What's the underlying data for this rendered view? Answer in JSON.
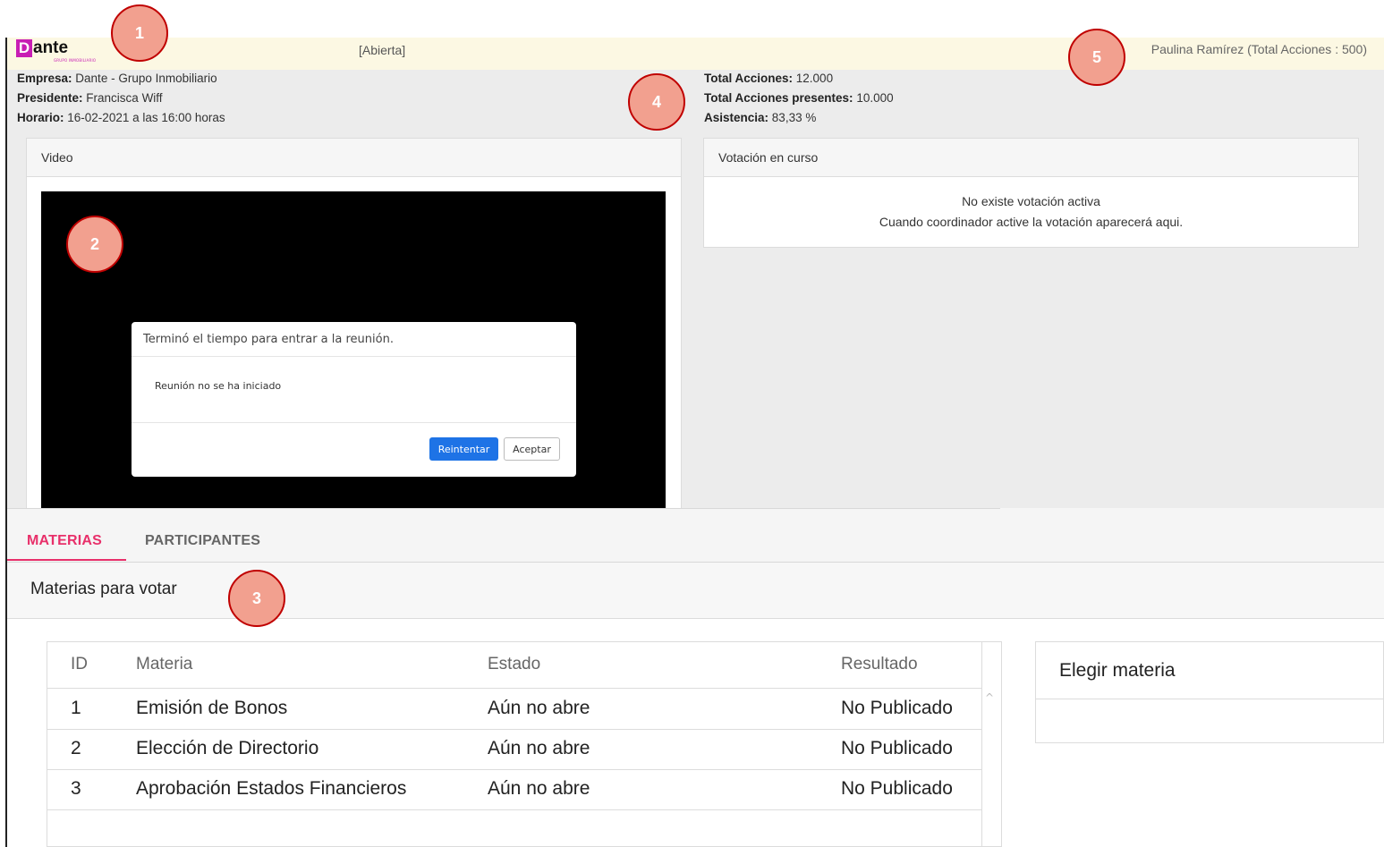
{
  "header": {
    "logo": {
      "letter": "D",
      "rest": "ante",
      "subtitle": "GRUPO INMOBILIARIO"
    },
    "status": "[Abierta]",
    "user": "Paulina Ramírez (Total Acciones : 500)"
  },
  "meeting_info": {
    "empresa_label": "Empresa:",
    "empresa_value": "Dante - Grupo Inmobiliario",
    "presidente_label": "Presidente:",
    "presidente_value": "Francisca Wiff",
    "horario_label": "Horario:",
    "horario_value": "16-02-2021 a las 16:00 horas"
  },
  "shares_info": {
    "total_label": "Total Acciones:",
    "total_value": "12.000",
    "presentes_label": "Total Acciones presentes:",
    "presentes_value": "10.000",
    "asistencia_label": "Asistencia:",
    "asistencia_value": "83,33 %"
  },
  "video_panel": {
    "title": "Video",
    "modal": {
      "title": "Terminó el tiempo para entrar a la reunión.",
      "body": "Reunión no se ha iniciado",
      "retry_label": "Reintentar",
      "accept_label": "Aceptar"
    }
  },
  "vote_panel": {
    "title": "Votación en curso",
    "line1": "No existe votación activa",
    "line2": "Cuando coordinador active la votación aparecerá aqui."
  },
  "tabs": [
    {
      "label": "MATERIAS",
      "active": true
    },
    {
      "label": "PARTICIPANTES",
      "active": false
    }
  ],
  "materias": {
    "title": "Materias para votar",
    "columns": [
      "ID",
      "Materia",
      "Estado",
      "Resultado"
    ],
    "rows": [
      [
        "1",
        "Emisión de Bonos",
        "Aún no abre",
        "No Publicado"
      ],
      [
        "2",
        "Elección de Directorio",
        "Aún no abre",
        "No Publicado"
      ],
      [
        "3",
        "Aprobación Estados Financieros",
        "Aún no abre",
        "No Publicado"
      ]
    ]
  },
  "choose": {
    "title": "Elegir materia"
  },
  "annotations": [
    "1",
    "2",
    "3",
    "4",
    "5"
  ],
  "colors": {
    "accent": "#e8306a",
    "header_bg": "#fcf8e3",
    "badge": "#f2a08f",
    "primary": "#1e73e6"
  }
}
